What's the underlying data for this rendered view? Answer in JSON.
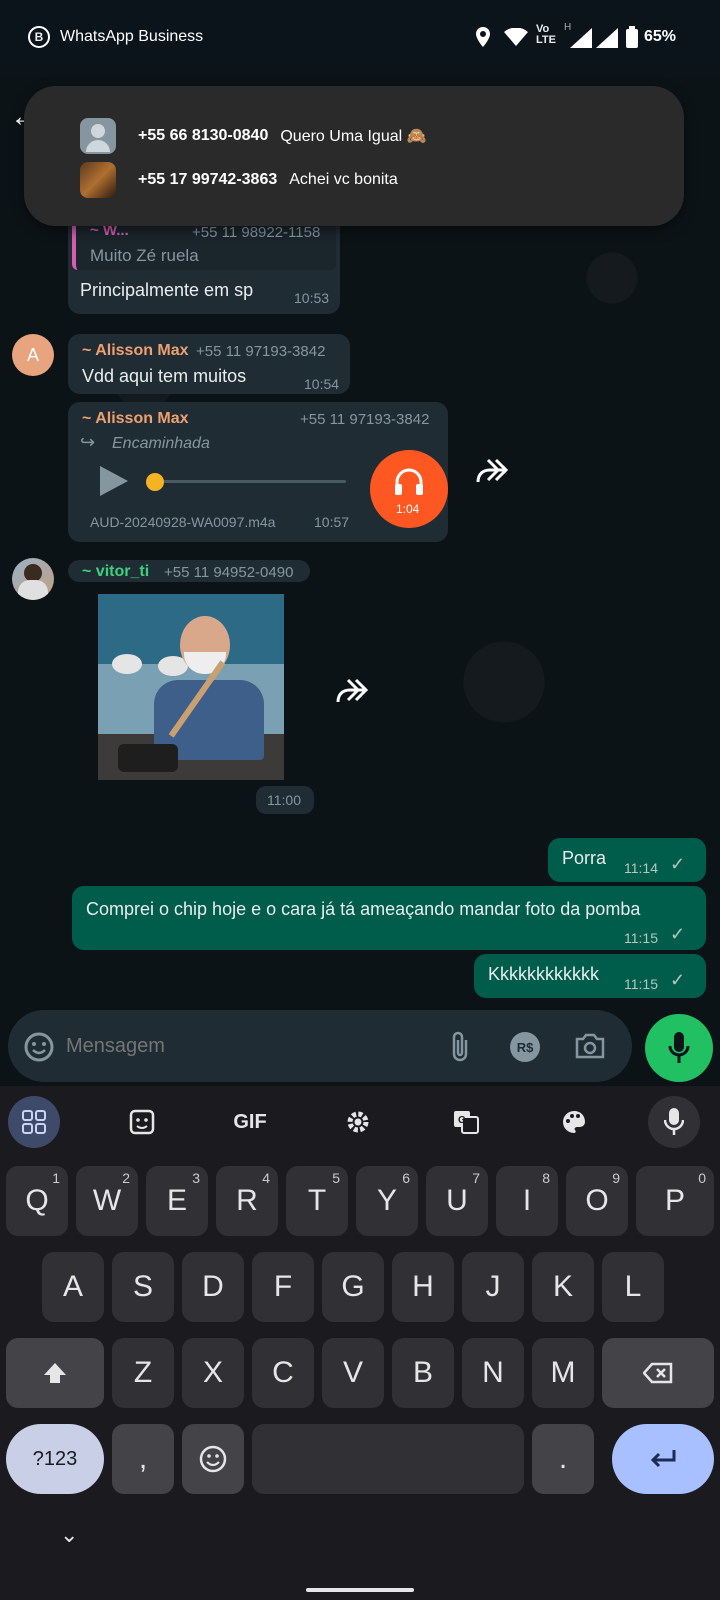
{
  "status_bar": {
    "app_name": "WhatsApp Business",
    "battery": "65%",
    "network": "Vo LTE"
  },
  "notification": {
    "rows": [
      {
        "phone": "+55 66 8130-0840",
        "text": "Quero Uma Igual 🙈"
      },
      {
        "phone": "+55 17 99742-3863",
        "text": "Achei  vc bonita"
      }
    ]
  },
  "messages": {
    "m1": {
      "quote_sender": "~ W...",
      "quote_phone": "+55 11 98922-1158",
      "quote_text": "Muito Zé ruela",
      "text": "Principalmente em sp",
      "time": "10:53"
    },
    "m2": {
      "avatar_letter": "A",
      "sender": "~ Alisson Max",
      "phone": "+55 11 97193-3842",
      "text": "Vdd aqui tem muitos",
      "time": "10:54"
    },
    "m3": {
      "sender": "~ Alisson Max",
      "phone": "+55 11 97193-3842",
      "forwarded": "Encaminhada",
      "filename": "AUD-20240928-WA0097.m4a",
      "time": "10:57",
      "duration": "1:04",
      "progress": 0.0
    },
    "m4": {
      "sender": "~ vitor_ti",
      "phone": "+55 11 94952-0490",
      "time": "11:00"
    },
    "m5": {
      "text": "Porra",
      "time": "11:14"
    },
    "m6": {
      "text": "Comprei o chip hoje e o cara já tá ameaçando mandar foto da pomba",
      "time": "11:15"
    },
    "m7": {
      "text": "Kkkkkkkkkkkk",
      "time": "11:15"
    }
  },
  "input": {
    "placeholder": "Mensagem",
    "currency_icon": "R$"
  },
  "keyboard": {
    "tools": {
      "gif": "GIF"
    },
    "row1": [
      {
        "k": "Q",
        "n": "1"
      },
      {
        "k": "W",
        "n": "2"
      },
      {
        "k": "E",
        "n": "3"
      },
      {
        "k": "R",
        "n": "4"
      },
      {
        "k": "T",
        "n": "5"
      },
      {
        "k": "Y",
        "n": "6"
      },
      {
        "k": "U",
        "n": "7"
      },
      {
        "k": "I",
        "n": "8"
      },
      {
        "k": "O",
        "n": "9"
      },
      {
        "k": "P",
        "n": "0"
      }
    ],
    "row2": [
      "A",
      "S",
      "D",
      "F",
      "G",
      "H",
      "J",
      "K",
      "L"
    ],
    "row3": [
      "Z",
      "X",
      "C",
      "V",
      "B",
      "N",
      "M"
    ],
    "sym": "?123",
    "comma": ",",
    "period": "."
  },
  "colors": {
    "accent_green": "#21c063",
    "audio_orange": "#ff5722",
    "out_bubble": "#005c4b",
    "in_bubble": "#1f2c34"
  }
}
